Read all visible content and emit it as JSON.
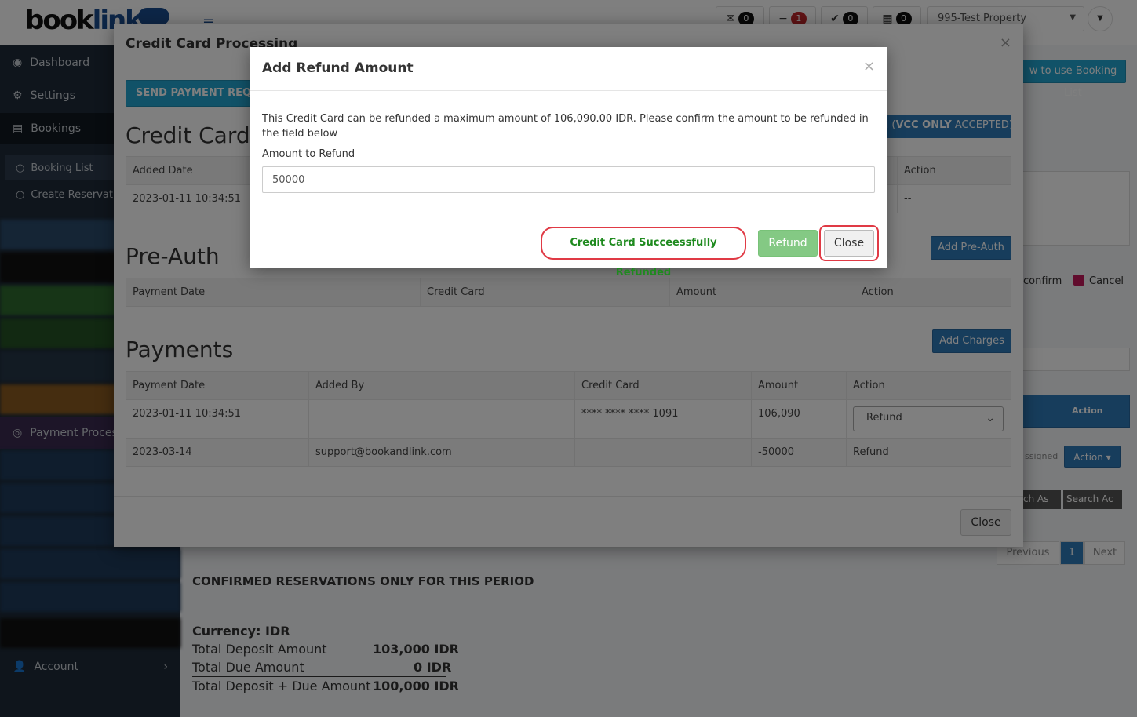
{
  "app": {
    "logo_main": "book",
    "logo_accent": "link",
    "badge_inbox": "0",
    "badge_minus": "1",
    "badge_check": "0",
    "badge_cal": "0",
    "property": "995-Test Property"
  },
  "sidebar": {
    "dashboard": "Dashboard",
    "settings": "Settings",
    "bookings": "Bookings",
    "booking_list": "Booking List",
    "create_reservation": "Create Reservati",
    "payment": "Payment Proces",
    "account": "Account"
  },
  "background": {
    "how_to_use": "w to use Booking List",
    "confirm": "confirm",
    "cancel": "Cancel",
    "col_sign": "ign\nn",
    "col_action": "Action",
    "assigned": "ssigned",
    "action_btn": "Action ▾",
    "search_as": "ch As",
    "search_ac": "Search Ac",
    "prev": "Previous",
    "page": "1",
    "next": "Next",
    "confirmed_title": "CONFIRMED RESERVATIONS ONLY FOR THIS PERIOD",
    "currency": "Currency: IDR",
    "totals": [
      {
        "label": "Total Deposit Amount",
        "value": "103,000 IDR"
      },
      {
        "label": "Total Due Amount",
        "value": "0 IDR"
      },
      {
        "label": "Total Deposit + Due Amount",
        "value": "100,000 IDR"
      }
    ]
  },
  "modal1": {
    "title": "Credit Card Processing",
    "send_payment": "SEND PAYMENT REQUEST",
    "vcc_prefix": "d (",
    "vcc_bold": "VCC ONLY",
    "vcc_suffix": " ACCEPTED)",
    "credit_cards_title": "Credit Cards",
    "cc_headers": {
      "added_date": "Added Date",
      "action": "Action"
    },
    "cc_row": {
      "added_date": "2023-01-11 10:34:51",
      "action": "--"
    },
    "preauth_title": "Pre-Auth",
    "add_preauth": "Add Pre-Auth",
    "preauth_headers": [
      "Payment Date",
      "Credit Card",
      "Amount",
      "Action"
    ],
    "payments_title": "Payments",
    "add_charges": "Add Charges",
    "payment_headers": [
      "Payment Date",
      "Added By",
      "Credit Card",
      "Amount",
      "Action"
    ],
    "payment_rows": [
      {
        "date": "2023-01-11 10:34:51",
        "by": "",
        "card": "**** **** **** 1091",
        "amount": "106,090",
        "action": "Refund"
      },
      {
        "date": "2023-03-14",
        "by": "support@bookandlink.com",
        "card": "",
        "amount": "-50000",
        "action": "Refund"
      }
    ],
    "close": "Close"
  },
  "modal2": {
    "title": "Add Refund Amount",
    "message": "This Credit Card can be refunded a maximum amount of 106,090.00 IDR. Please confirm the amount to be refunded in the field below",
    "label": "Amount to Refund",
    "amount_value": "50000",
    "success": "Credit Card Succeessfully Refunded",
    "refund_btn": "Refund",
    "close_btn": "Close"
  }
}
